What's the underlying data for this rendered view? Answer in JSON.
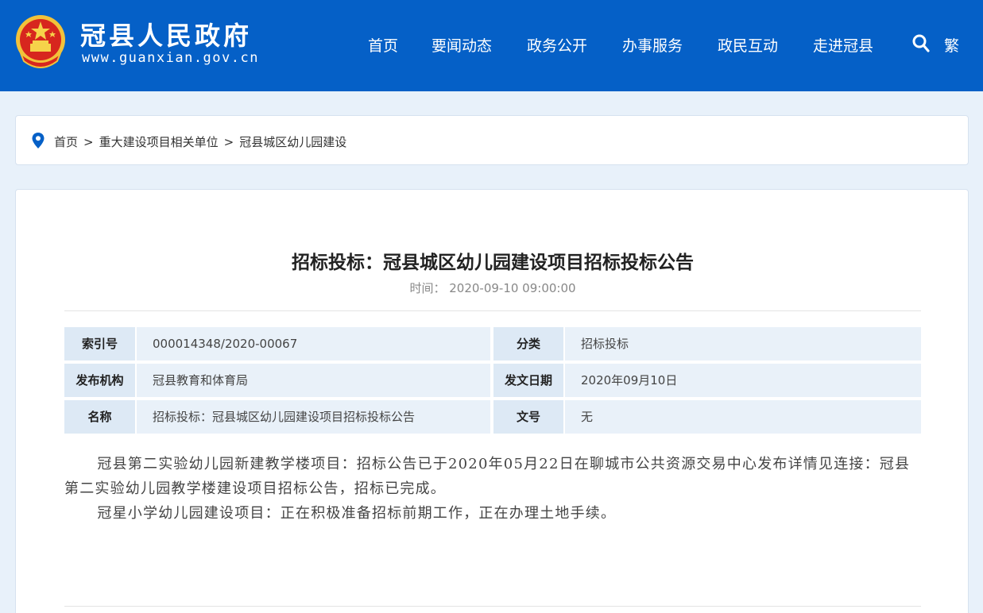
{
  "header": {
    "site_title": "冠县人民政府",
    "site_url": "www.guanxian.gov.cn",
    "nav": [
      {
        "label": "首页"
      },
      {
        "label": "要闻动态"
      },
      {
        "label": "政务公开"
      },
      {
        "label": "办事服务"
      },
      {
        "label": "政民互动"
      },
      {
        "label": "走进冠县"
      }
    ],
    "traditional_label": "繁",
    "search_icon": "search-icon",
    "brand_color": "#0560c7"
  },
  "breadcrumb": {
    "icon": "location-pin-icon",
    "items": [
      "首页",
      "重大建设项目相关单位",
      "冠县城区幼儿园建设"
    ],
    "separator": ">"
  },
  "article": {
    "title": "招标投标：冠县城区幼儿园建设项目招标投标公告",
    "time_label": "时间：",
    "time_value": "2020-09-10 09:00:00",
    "meta": [
      {
        "label1": "索引号",
        "value1": "000014348/2020-00067",
        "label2": "分类",
        "value2": "招标投标"
      },
      {
        "label1": "发布机构",
        "value1": "冠县教育和体育局",
        "label2": "发文日期",
        "value2": "2020年09月10日"
      },
      {
        "label1": "名称",
        "value1": "招标投标：冠县城区幼儿园建设项目招标投标公告",
        "label2": "文号",
        "value2": "无"
      }
    ],
    "paragraphs": [
      "冠县第二实验幼儿园新建教学楼项目：招标公告已于2020年05月22日在聊城市公共资源交易中心发布详情见连接：冠县第二实验幼儿园教学楼建设项目招标公告，招标已完成。",
      "冠星小学幼儿园建设项目：正在积极准备招标前期工作，正在办理土地手续。"
    ]
  }
}
